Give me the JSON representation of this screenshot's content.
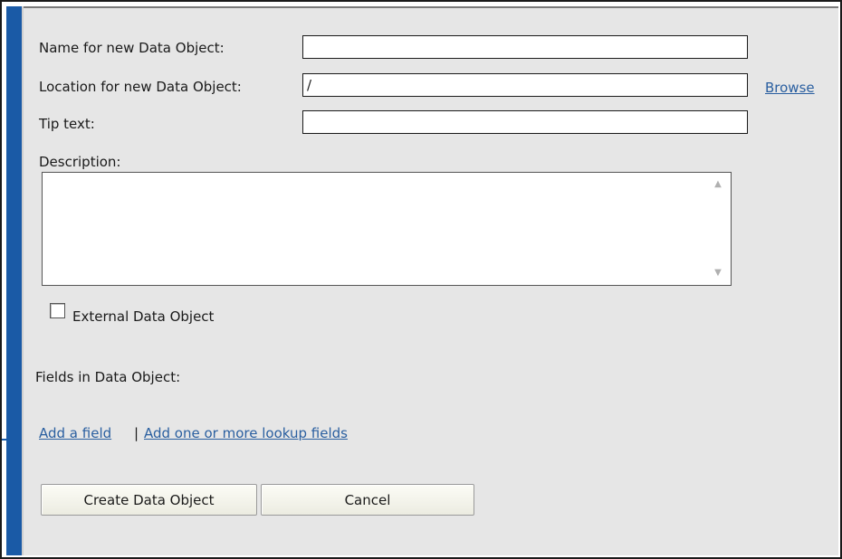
{
  "form": {
    "name_label": "Name for new Data Object:",
    "name_value": "",
    "location_label": "Location for new Data Object:",
    "location_value": "/",
    "browse_link": "Browse",
    "tip_label": "Tip text:",
    "tip_value": "",
    "description_label": "Description:",
    "description_value": "",
    "external_label": "External Data Object",
    "external_checked": false,
    "fields_label": "Fields in Data Object:",
    "add_field_link": "Add a field",
    "separator": "|",
    "add_lookup_link": "Add one or more lookup fields"
  },
  "buttons": {
    "create": "Create Data Object",
    "cancel": "Cancel"
  },
  "icons": {
    "scroll_up": "chevron-up-icon",
    "scroll_down": "chevron-down-icon"
  },
  "colors": {
    "accent": "#1a5aa6",
    "panel_bg": "#e6e6e6",
    "link": "#2a5fa0"
  }
}
